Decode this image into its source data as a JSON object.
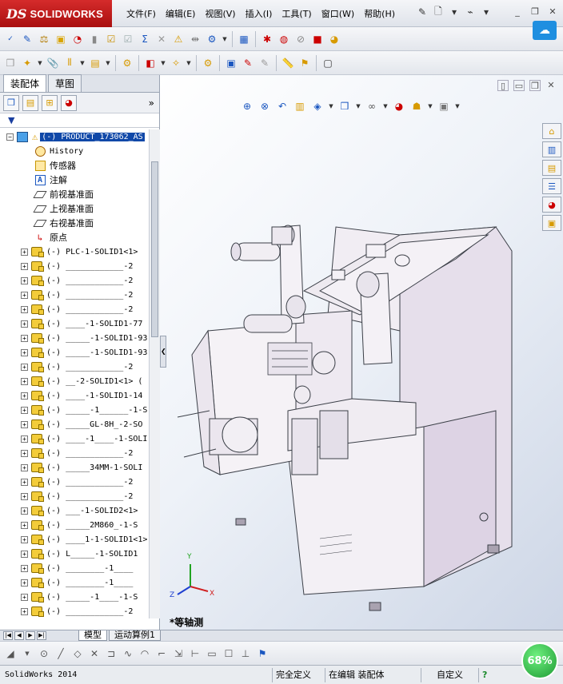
{
  "app": {
    "logo_ds": "DS",
    "logo_name": "SOLIDWORKS"
  },
  "menu": [
    "文件(F)",
    "编辑(E)",
    "视图(V)",
    "插入(I)",
    "工具(T)",
    "窗口(W)",
    "帮助(H)"
  ],
  "panel_tabs": [
    "装配体",
    "草图"
  ],
  "fm_expand": "»",
  "filter": "▼",
  "tree": {
    "root": "(-) PRODUCT_173062_AS",
    "items": [
      {
        "icon": "hist",
        "label": "History"
      },
      {
        "icon": "sensor",
        "label": "传感器"
      },
      {
        "icon": "note",
        "label": "注解"
      },
      {
        "icon": "plane",
        "label": "前视基准面"
      },
      {
        "icon": "plane",
        "label": "上视基准面"
      },
      {
        "icon": "plane",
        "label": "右视基准面"
      },
      {
        "icon": "origin",
        "label": "原点"
      }
    ],
    "parts": [
      "(-) PLC-1-SOLID1<1>",
      "(-) ____________-2",
      "(-) ____________-2",
      "(-) ____________-2",
      "(-) ____________-2",
      "(-) ____-1-SOLID1-77",
      "(-) _____-1-SOLID1-93",
      "(-) _____-1-SOLID1-93",
      "(-) ____________-2",
      "(-) __-2-SOLID1<1> (",
      "(-) ____-1-SOLID1-14",
      "(-) _____-1______-1-S",
      "(-) _____GL-8H_-2-SO",
      "(-) ____-1____-1-SOLI",
      "(-) ____________-2",
      "(-) _____34MM-1-SOLI",
      "(-) ____________-2",
      "(-) ____________-2",
      "(-) ___-1-SOLID2<1>",
      "(-) _____2M860_-1-S",
      "(-) ____1-1-SOLID1<1>",
      "(-) L_____-1-SOLID1",
      "(-) ________-1____",
      "(-) ________-1____",
      "(-) _____-1____-1-S",
      "(-) ____________-2"
    ]
  },
  "viewport": {
    "view_name": "*等轴测"
  },
  "triad": {
    "x": "X",
    "y": "Y",
    "z": "Z"
  },
  "bottom_tabs": [
    "模型",
    "运动算例1"
  ],
  "status": {
    "app": "SolidWorks 2014",
    "defined": "完全定义",
    "editing": "在编辑 装配体",
    "units": "自定义",
    "help": "?"
  },
  "zoom": "68%",
  "colors": {
    "brand_red": "#c41e1e",
    "selection": "#1048a8",
    "zoom_green": "#2fb84a",
    "machine_purple": "#e9e2ef"
  }
}
